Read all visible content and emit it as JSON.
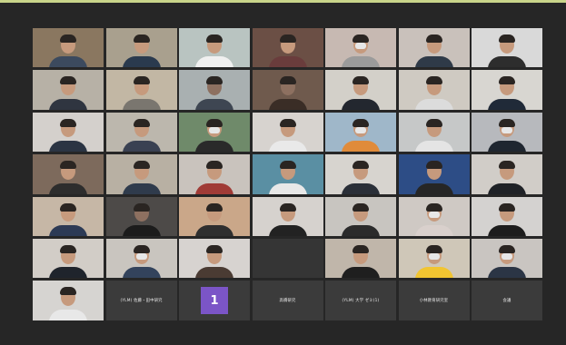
{
  "meeting": {
    "participants": [
      {
        "kind": "camera",
        "bg": "#8a7760",
        "shirt": "#3c4a5e",
        "mask": false,
        "lit": true
      },
      {
        "kind": "camera",
        "bg": "#a9a08e",
        "shirt": "#2a3a4e",
        "mask": false,
        "lit": true
      },
      {
        "kind": "camera",
        "bg": "#b9c4c1",
        "shirt": "#f0f0f0",
        "mask": false,
        "lit": true
      },
      {
        "kind": "camera",
        "bg": "#6b4f45",
        "shirt": "#6a3c3c",
        "mask": false,
        "lit": true
      },
      {
        "kind": "camera",
        "bg": "#c7b9b2",
        "shirt": "#9b9b9b",
        "mask": true,
        "lit": true
      },
      {
        "kind": "camera",
        "bg": "#c9c1bb",
        "shirt": "#2f3a48",
        "mask": false,
        "lit": true
      },
      {
        "kind": "camera",
        "bg": "#d9d9d9",
        "shirt": "#2d2d2d",
        "mask": false,
        "lit": true
      },
      {
        "kind": "camera",
        "bg": "#b7b1a6",
        "shirt": "#2f3540",
        "mask": false,
        "lit": true
      },
      {
        "kind": "camera",
        "bg": "#c2b7a4",
        "shirt": "#7a766f",
        "mask": false,
        "lit": true
      },
      {
        "kind": "camera",
        "bg": "#a9b0b1",
        "shirt": "#3e4652",
        "mask": false,
        "lit": false
      },
      {
        "kind": "camera",
        "bg": "#6f5a4d",
        "shirt": "#3a2d26",
        "mask": false,
        "lit": false
      },
      {
        "kind": "camera",
        "bg": "#d3d0c9",
        "shirt": "#23272f",
        "mask": false,
        "lit": true
      },
      {
        "kind": "camera",
        "bg": "#cfcac2",
        "shirt": "#dcdcdc",
        "mask": false,
        "lit": true
      },
      {
        "kind": "camera",
        "bg": "#d8d6d1",
        "shirt": "#202a38",
        "mask": false,
        "lit": true
      },
      {
        "kind": "camera",
        "bg": "#d4d0cc",
        "shirt": "#2b3443",
        "mask": false,
        "lit": true
      },
      {
        "kind": "camera",
        "bg": "#bcb7ad",
        "shirt": "#3a4152",
        "mask": false,
        "lit": true
      },
      {
        "kind": "camera",
        "bg": "#6f8a6a",
        "shirt": "#2a2a2a",
        "mask": true,
        "lit": true
      },
      {
        "kind": "camera",
        "bg": "#d7d3cf",
        "shirt": "#e9e9e9",
        "mask": false,
        "lit": true
      },
      {
        "kind": "camera",
        "bg": "#9fb7c9",
        "shirt": "#e08b3a",
        "mask": true,
        "lit": true
      },
      {
        "kind": "camera",
        "bg": "#c6c8c8",
        "shirt": "#e4e4e4",
        "mask": false,
        "lit": true
      },
      {
        "kind": "camera",
        "bg": "#b7b9bd",
        "shirt": "#1f2630",
        "mask": true,
        "lit": true
      },
      {
        "kind": "camera",
        "bg": "#7d6a5c",
        "shirt": "#2d2d2d",
        "mask": false,
        "lit": true
      },
      {
        "kind": "camera",
        "bg": "#b8b0a3",
        "shirt": "#2f3b4c",
        "mask": false,
        "lit": true
      },
      {
        "kind": "camera",
        "bg": "#c9c3bd",
        "shirt": "#a03b36",
        "mask": false,
        "lit": true
      },
      {
        "kind": "camera",
        "bg": "#5a8fa3",
        "shirt": "#e8e8e8",
        "mask": false,
        "lit": true
      },
      {
        "kind": "camera",
        "bg": "#d7d4cf",
        "shirt": "#2a2f38",
        "mask": false,
        "lit": true
      },
      {
        "kind": "camera",
        "bg": "#2d4d86",
        "shirt": "#262626",
        "mask": false,
        "lit": true
      },
      {
        "kind": "camera",
        "bg": "#d1cdc8",
        "shirt": "#1f2227",
        "mask": false,
        "lit": true
      },
      {
        "kind": "camera",
        "bg": "#c6b7a6",
        "shirt": "#2c3a55",
        "mask": false,
        "lit": true
      },
      {
        "kind": "camera",
        "bg": "#4d4a48",
        "shirt": "#1c1c1c",
        "mask": false,
        "lit": false
      },
      {
        "kind": "camera",
        "bg": "#caa789",
        "shirt": "#2f2f2f",
        "mask": false,
        "lit": true
      },
      {
        "kind": "camera",
        "bg": "#d6d2ce",
        "shirt": "#222222",
        "mask": false,
        "lit": true
      },
      {
        "kind": "camera",
        "bg": "#c8c5c0",
        "shirt": "#2b2b2b",
        "mask": false,
        "lit": true
      },
      {
        "kind": "camera",
        "bg": "#cfc9c4",
        "shirt": "#d9d0cc",
        "mask": true,
        "lit": true
      },
      {
        "kind": "camera",
        "bg": "#d4d2d0",
        "shirt": "#1d1d1d",
        "mask": false,
        "lit": true
      },
      {
        "kind": "camera",
        "bg": "#d2cdc7",
        "shirt": "#1f242c",
        "mask": false,
        "lit": true
      },
      {
        "kind": "camera",
        "bg": "#c9c5bf",
        "shirt": "#33435c",
        "mask": true,
        "lit": true
      },
      {
        "kind": "camera",
        "bg": "#d7d3d0",
        "shirt": "#4a3b33",
        "mask": false,
        "lit": true
      },
      {
        "kind": "blank"
      },
      {
        "kind": "camera",
        "bg": "#c0b6aa",
        "shirt": "#1f1f1f",
        "mask": false,
        "lit": true
      },
      {
        "kind": "camera",
        "bg": "#cfc7b8",
        "shirt": "#f1c531",
        "mask": true,
        "lit": true
      },
      {
        "kind": "camera",
        "bg": "#c9c5c1",
        "shirt": "#2b3545",
        "mask": true,
        "lit": true
      },
      {
        "kind": "camera",
        "bg": "#d6d4d1",
        "shirt": "#e8e8e8",
        "mask": false,
        "lit": true
      },
      {
        "kind": "name",
        "label": "(YLM) 佐藤・田中研究"
      },
      {
        "kind": "number",
        "label": "1"
      },
      {
        "kind": "name",
        "label": "高橋研究"
      },
      {
        "kind": "name",
        "label": "(YLM) 大学 ゼミ(1)"
      },
      {
        "kind": "name",
        "label": "小林教育研究室"
      },
      {
        "kind": "name",
        "label": "会議"
      }
    ]
  }
}
